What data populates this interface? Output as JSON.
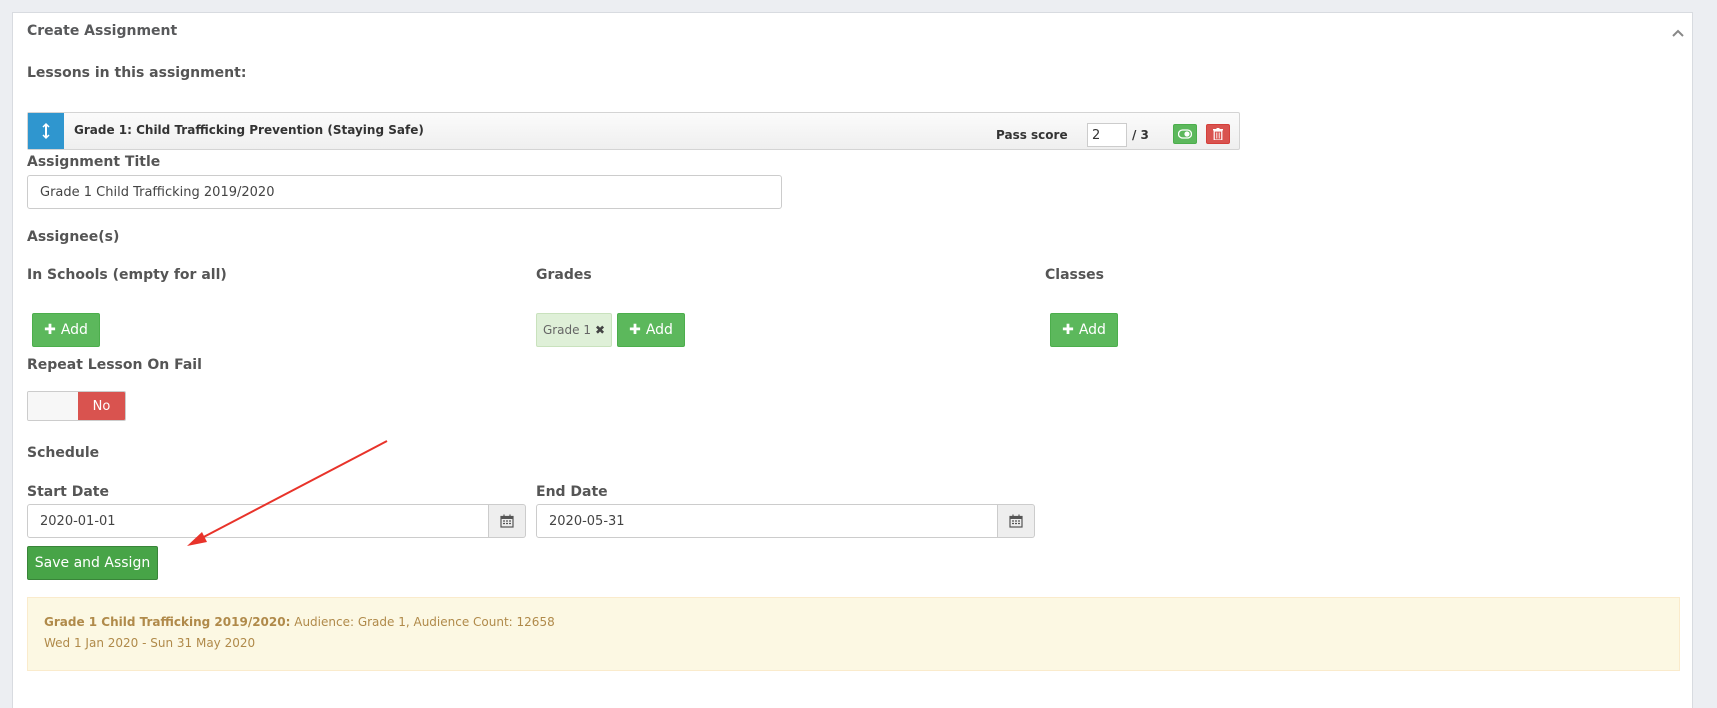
{
  "panel": {
    "title": "Create Assignment"
  },
  "lessons": {
    "heading": "Lessons in this assignment:",
    "items": [
      {
        "name": "Grade 1: Child Trafficking Prevention (Staying Safe)",
        "pass_score_label": "Pass score",
        "pass_score_value": "2",
        "pass_score_total": "/ 3"
      }
    ]
  },
  "assignment_title": {
    "label": "Assignment Title",
    "value": "Grade 1 Child Trafficking 2019/2020"
  },
  "assignees": {
    "heading": "Assignee(s)",
    "schools": {
      "label": "In Schools (empty for all)",
      "add_label": "Add"
    },
    "grades": {
      "label": "Grades",
      "tags": [
        "Grade 1"
      ],
      "add_label": "Add"
    },
    "classes": {
      "label": "Classes",
      "add_label": "Add"
    }
  },
  "repeat_on_fail": {
    "label": "Repeat Lesson On Fail",
    "state_label": "No"
  },
  "schedule": {
    "heading": "Schedule",
    "start": {
      "label": "Start Date",
      "value": "2020-01-01"
    },
    "end": {
      "label": "End Date",
      "value": "2020-05-31"
    }
  },
  "save_button": "Save and Assign",
  "summary": {
    "title": "Grade 1 Child Trafficking 2019/2020:",
    "details": "Audience: Grade 1, Audience Count: 12658",
    "date_range": "Wed 1 Jan 2020 - Sun 31 May 2020"
  },
  "colors": {
    "primary_green": "#5cb85c",
    "danger_red": "#d9534f",
    "info_blue": "#2f96cf",
    "warning_bg": "#fcf8e3",
    "annotation_arrow": "#e8332a"
  }
}
